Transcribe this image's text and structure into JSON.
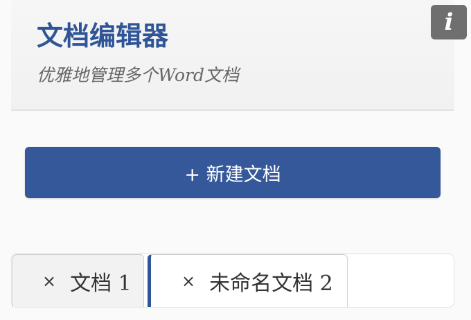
{
  "header": {
    "title": "文档编辑器",
    "subtitle": "优雅地管理多个Word文档",
    "info_button_label": "i"
  },
  "toolbar": {
    "new_document_label": "+ 新建文档"
  },
  "tabs": [
    {
      "close_label": "×",
      "label": "文档 1",
      "active": false
    },
    {
      "close_label": "×",
      "label": "未命名文档 2",
      "active": true
    }
  ],
  "colors": {
    "accent": "#2f5597",
    "button": "#35589b",
    "info_button": "#6f6f6f"
  }
}
